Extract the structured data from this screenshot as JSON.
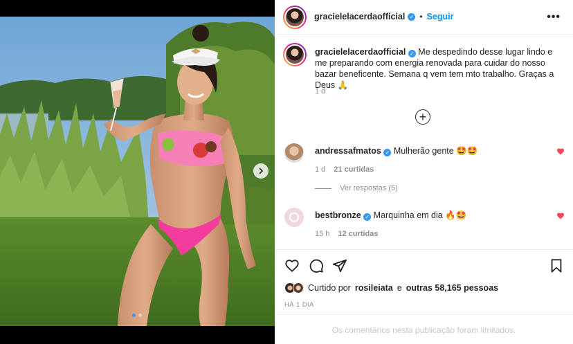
{
  "post": {
    "author": "gracielelacerdaofficial",
    "follow_label": "Seguir",
    "more_label": "•••",
    "caption_user": "gracielelacerdaofficial",
    "caption_text": "Me despedindo desse lugar lindo e me preparando com energia renovada para cuidar do nosso bazar beneficente. Semana q vem tem mto trabalho. Graças a Deus 🙏",
    "caption_time": "1 d",
    "load_more_label": "+"
  },
  "comments": [
    {
      "user": "andressafmatos",
      "text": "Mulherão gente 🤩🤩",
      "time": "1 d",
      "likes": "21 curtidas",
      "replies": "Ver respostas (5)"
    },
    {
      "user": "bestbronze",
      "text": "Marquinha em dia 🔥🤩",
      "time": "15 h",
      "likes": "12 curtidas"
    }
  ],
  "likes": {
    "prefix": "Curtido por",
    "user": "rosileiata",
    "middle": "e",
    "others": "outras 58,165 pessoas"
  },
  "post_date": "HÁ 1 DIA",
  "comments_limited": "Os comentários nesta publicação foram limitados.",
  "icons": [
    "heart-icon",
    "comment-icon",
    "share-icon",
    "bookmark-icon",
    "plus-circle-icon",
    "chevron-right-icon",
    "more-icon",
    "verified-icon"
  ],
  "colors": {
    "accent": "#0095f6",
    "verified": "#3897f0",
    "like": "#ed4956"
  },
  "carousel": {
    "slides": 2,
    "active": 1
  }
}
